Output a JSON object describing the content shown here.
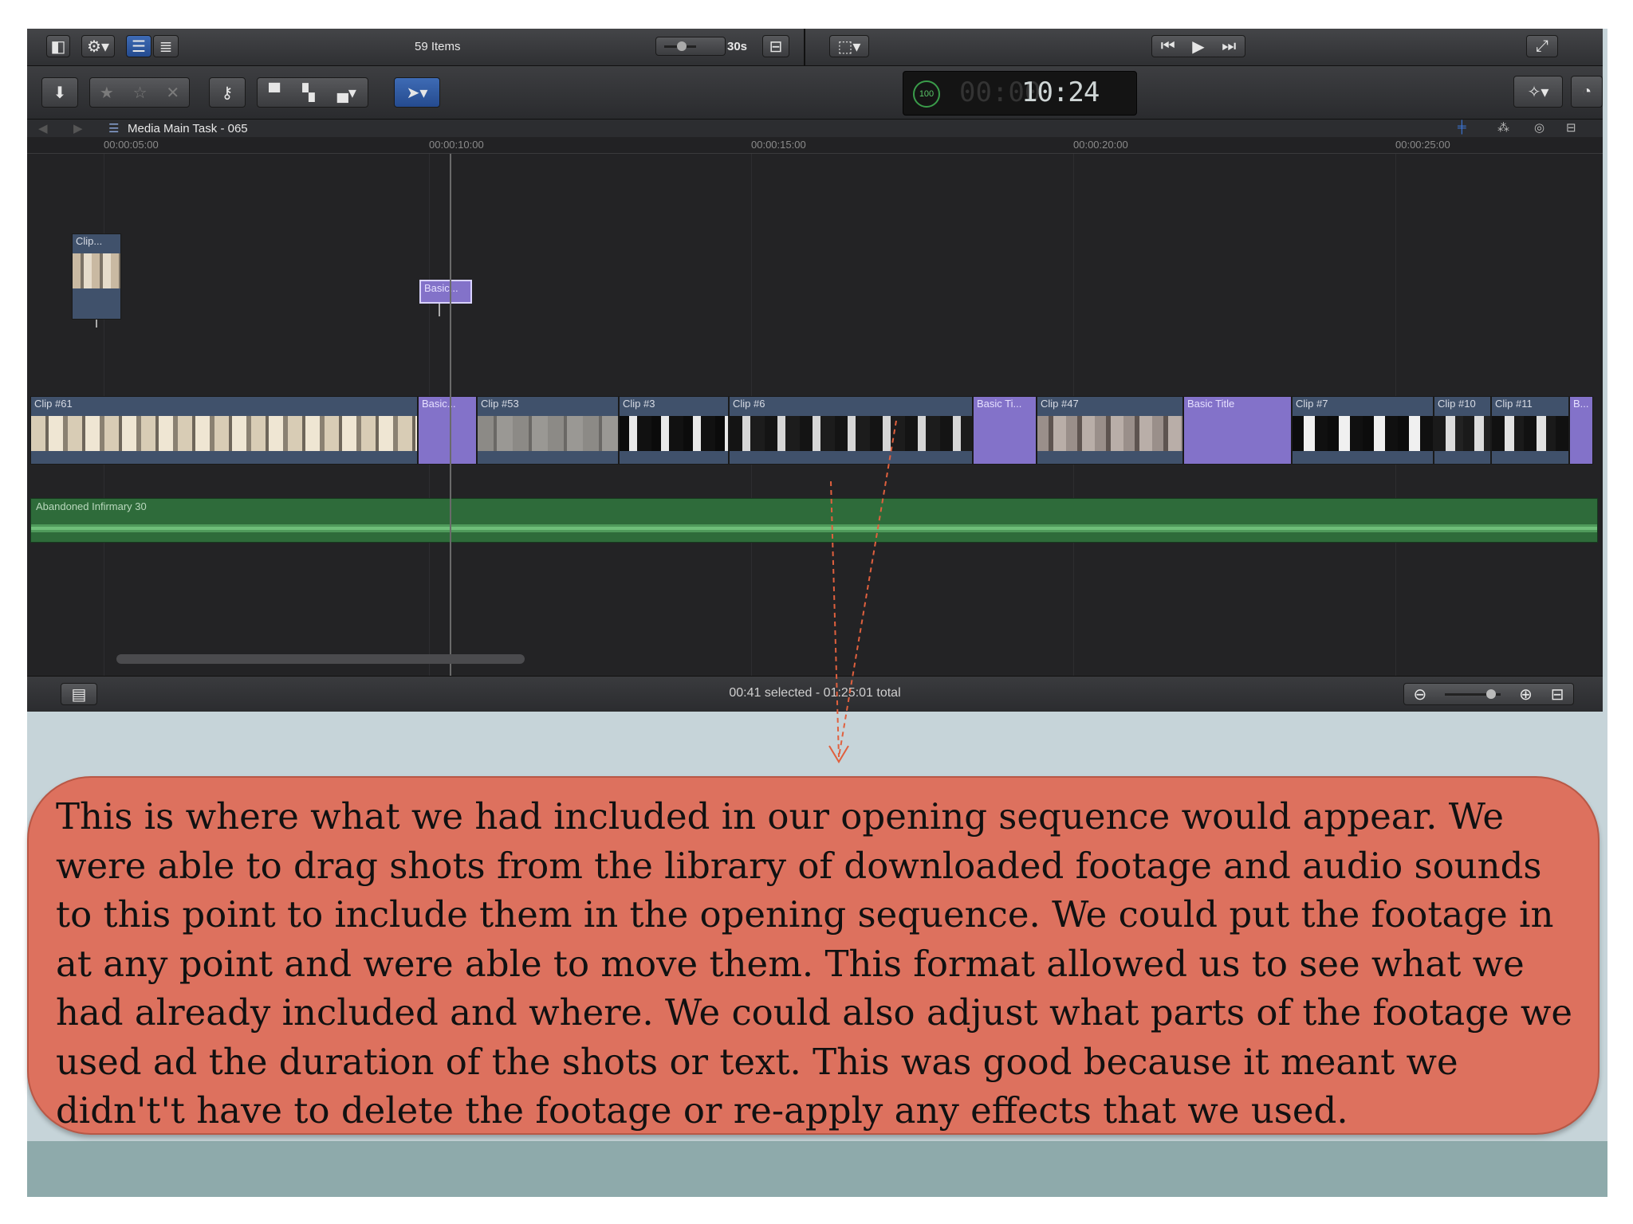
{
  "toolbar": {
    "items_count": "59 Items",
    "clip_duration": "30s",
    "timecode": "10:24",
    "timecode_ghost": "00:00",
    "percent_badge": "100",
    "colors": {
      "accent": "#2f5ea8",
      "title_clip": "#8372c9",
      "video_clip": "#40516b",
      "audio_clip": "#2e6b3a"
    }
  },
  "project": {
    "name": "Media Main Task - 065"
  },
  "ruler": {
    "ticks": [
      "00:00:05:00",
      "00:00:10:00",
      "00:00:15:00",
      "00:00:20:00",
      "00:00:25:00"
    ]
  },
  "timeline": {
    "connected": [
      {
        "label": "Clip..."
      },
      {
        "label": "Basic..."
      }
    ],
    "clips": [
      {
        "label": "Clip #61"
      },
      {
        "label": "Basic..."
      },
      {
        "label": "Clip #53"
      },
      {
        "label": "Clip #3"
      },
      {
        "label": "Clip #6"
      },
      {
        "label": "Basic Ti..."
      },
      {
        "label": "Clip #47"
      },
      {
        "label": "Basic Title"
      },
      {
        "label": "Clip #7"
      },
      {
        "label": "Clip #10"
      },
      {
        "label": "Clip #11"
      },
      {
        "label": "B..."
      }
    ],
    "audio_label": "Abandoned Infirmary 30"
  },
  "status": {
    "text": "00:41 selected - 01:25:01 total"
  },
  "callout": {
    "text": "This is where what we had included in our opening sequence would appear. We were able to drag shots from the library of downloaded footage and audio sounds to this point to include them in the opening sequence. We could put the footage in at any point and were able to move them. This format allowed us to see what we had already included and where. We could also adjust what parts of the footage we used ad the duration of the shots or text. This was good because it meant we didn't't have to delete the footage or re-apply any effects that we used."
  }
}
